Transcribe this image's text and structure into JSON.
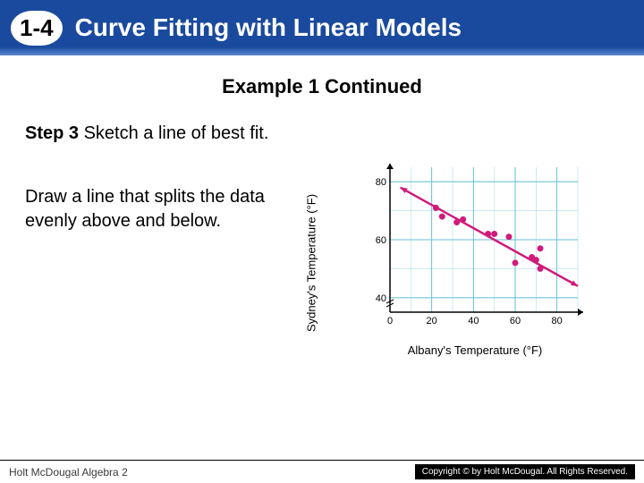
{
  "header": {
    "chapter_number": "1-4",
    "chapter_title": "Curve Fitting with Linear Models"
  },
  "example_title": "Example 1 Continued",
  "step": {
    "label": "Step 3",
    "text": "Sketch a line of best fit."
  },
  "instruction": "Draw a line that splits the data evenly above and below.",
  "chart_data": {
    "type": "scatter",
    "title": "",
    "xlabel": "Albany's Temperature (°F)",
    "ylabel": "Sydney's Temperature (°F)",
    "xlim": [
      0,
      90
    ],
    "ylim": [
      35,
      85
    ],
    "xticks": [
      0,
      20,
      40,
      60,
      80
    ],
    "yticks": [
      40,
      60,
      80
    ],
    "series": [
      {
        "name": "data-points",
        "type": "scatter",
        "color": "#d11a7a",
        "points": [
          {
            "x": 22,
            "y": 71
          },
          {
            "x": 25,
            "y": 68
          },
          {
            "x": 32,
            "y": 66
          },
          {
            "x": 35,
            "y": 67
          },
          {
            "x": 47,
            "y": 62
          },
          {
            "x": 50,
            "y": 62
          },
          {
            "x": 57,
            "y": 61
          },
          {
            "x": 60,
            "y": 52
          },
          {
            "x": 68,
            "y": 54
          },
          {
            "x": 70,
            "y": 53
          },
          {
            "x": 72,
            "y": 57
          },
          {
            "x": 72,
            "y": 50
          }
        ]
      },
      {
        "name": "best-fit-line",
        "type": "line",
        "color": "#d11a7a",
        "points": [
          {
            "x": 5,
            "y": 78
          },
          {
            "x": 90,
            "y": 44
          }
        ]
      }
    ]
  },
  "footer": {
    "left": "Holt McDougal Algebra 2",
    "right": "Copyright © by Holt McDougal. All Rights Reserved."
  }
}
